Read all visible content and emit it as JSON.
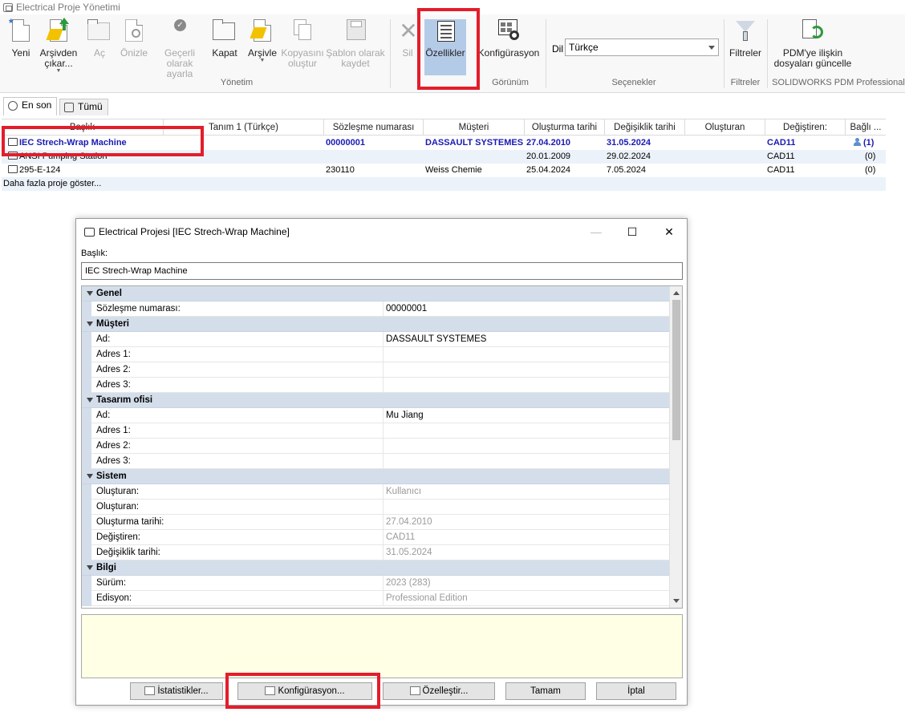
{
  "app": {
    "title": "Electrical Proje Yönetimi"
  },
  "ribbon": {
    "buttons": {
      "yeni": "Yeni",
      "arsivden": "Arşivden\nçıkar...",
      "ac": "Aç",
      "onizle": "Önizle",
      "gecerli": "Geçerli\nolarak ayarla",
      "kapat": "Kapat",
      "arsivle": "Arşivle",
      "kopyasini": "Kopyasını\noluştur",
      "sablon": "Şablon olarak\nkaydet",
      "sil": "Sil",
      "ozellikler": "Özellikler",
      "konfigurasyon": "Konfigürasyon",
      "filtreler": "Filtreler",
      "pdm": "PDM'ye ilişkin\ndosyaları güncelle"
    },
    "groups": {
      "yonetim": "Yönetim",
      "gorunum": "Görünüm",
      "secenekler": "Seçenekler",
      "filtreler": "Filtreler",
      "pdm": "SOLIDWORKS PDM Professional"
    },
    "language": {
      "label": "Dil",
      "value": "Türkçe"
    }
  },
  "tabs": {
    "recent": "En son",
    "all": "Tümü"
  },
  "grid": {
    "headers": [
      "Başlık",
      "Tanım 1 (Türkçe)",
      "Sözleşme numarası",
      "Müşteri",
      "Oluşturma tarihi",
      "Değişiklik tarihi",
      "Oluşturan",
      "Değiştiren:",
      "Bağlı ..."
    ],
    "rows": [
      {
        "title": "IEC Strech-Wrap Machine",
        "desc": "",
        "contract": "00000001",
        "customer": "DASSAULT SYSTEMES",
        "created": "27.04.2010",
        "modified": "31.05.2024",
        "creator": "",
        "modifier": "CAD11",
        "linked": "(1)"
      },
      {
        "title": "ANSI Pumping Station",
        "desc": "",
        "contract": "",
        "customer": "",
        "created": "20.01.2009",
        "modified": "29.02.2024",
        "creator": "",
        "modifier": "CAD11",
        "linked": "(0)"
      },
      {
        "title": "295-E-124",
        "desc": "",
        "contract": "230110",
        "customer": "Weiss Chemie",
        "created": "25.04.2024",
        "modified": "7.05.2024",
        "creator": "",
        "modifier": "CAD11",
        "linked": "(0)"
      }
    ],
    "more": "Daha fazla proje göster..."
  },
  "dialog": {
    "title": "Electrical Projesi [IEC Strech-Wrap Machine]",
    "baslik_label": "Başlık:",
    "baslik_value": "IEC Strech-Wrap Machine",
    "categories": {
      "genel": "Genel",
      "musteri": "Müşteri",
      "tasarim": "Tasarım ofisi",
      "sistem": "Sistem",
      "bilgi": "Bilgi"
    },
    "props": {
      "sozlesme_k": "Sözleşme numarası:",
      "sozlesme_v": "00000001",
      "m_ad_k": "Ad:",
      "m_ad_v": "DASSAULT SYSTEMES",
      "m_a1_k": "Adres 1:",
      "m_a2_k": "Adres 2:",
      "m_a3_k": "Adres 3:",
      "t_ad_k": "Ad:",
      "t_ad_v": "Mu Jiang",
      "t_a1_k": "Adres 1:",
      "t_a2_k": "Adres 2:",
      "t_a3_k": "Adres 3:",
      "s_olus_k": "Oluşturan:",
      "s_olus_v": "Kullanıcı",
      "s_olus2_k": "Oluşturan:",
      "s_olt_k": "Oluşturma tarihi:",
      "s_olt_v": "27.04.2010",
      "s_deg_k": "Değiştiren:",
      "s_deg_v": "CAD11",
      "s_degt_k": "Değişiklik tarihi:",
      "s_degt_v": "31.05.2024",
      "b_surum_k": "Sürüm:",
      "b_surum_v": "2023 (283)",
      "b_edisyon_k": "Edisyon:",
      "b_edisyon_v": "Professional Edition"
    },
    "buttons": {
      "istatistikler": "İstatistikler...",
      "konfigurasyon": "Konfigürasyon...",
      "ozellestir": "Özelleştir...",
      "tamam": "Tamam",
      "iptal": "İptal"
    }
  },
  "colors": {
    "highlight": "#e31d2b",
    "selected_button": "#b4cbe8",
    "bold_row": "#1a1ab4",
    "category": "#d4deeb"
  }
}
